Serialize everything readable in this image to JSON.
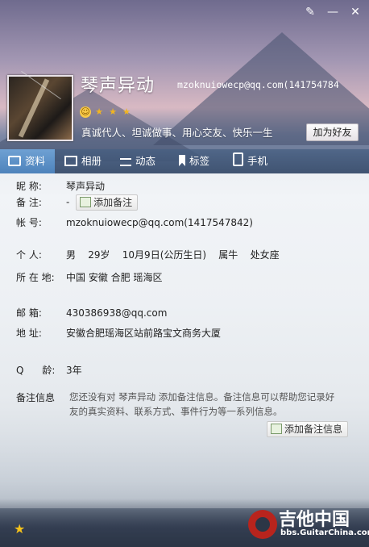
{
  "window": {
    "skin_icon": "brush-icon",
    "min_icon": "minimize-icon",
    "close_icon": "close-icon",
    "skin_glyph": "✎",
    "min_glyph": "—",
    "close_glyph": "✕"
  },
  "profile": {
    "nickname": "琴声异动",
    "email_header": "mzoknuiowecp@qq.com(141754784",
    "signature": "真诚代人、坦诚做事、用心交友、快乐一生",
    "add_friend": "加为好友",
    "level_icons": [
      "smiley-icon",
      "star-icon",
      "star-icon",
      "star-icon"
    ]
  },
  "tabs": [
    {
      "label": "资料",
      "icon": "card-icon"
    },
    {
      "label": "相册",
      "icon": "photo-icon"
    },
    {
      "label": "动态",
      "icon": "list-icon"
    },
    {
      "label": "标签",
      "icon": "tag-icon"
    },
    {
      "label": "手机",
      "icon": "phone-icon"
    }
  ],
  "details": {
    "nick_label": "昵    称:",
    "nick_value": "琴声异动",
    "remark_label": "备    注:",
    "remark_value": "-",
    "add_remark": "添加备注",
    "account_label": "帐    号:",
    "account_value": "mzoknuiowecp@qq.com(1417547842)",
    "personal_label": "个    人:",
    "personal_value": "男    29岁    10月9日(公历生日)    属牛    处女座",
    "location_label": "所 在 地:",
    "location_value": "中国 安徽 合肥 瑶海区",
    "email_label": "邮    箱:",
    "email_value": "430386938@qq.com",
    "address_label": "地    址:",
    "address_value": "安徽合肥瑶海区站前路宝文商务大厦",
    "qage_label": "Q      龄:",
    "qage_value": "3年",
    "note_label": "备注信息",
    "note_text": "您还没有对 琴声异动 添加备注信息。备注信息可以帮助您记录好友的真实资料、联系方式、事件行为等一系列信息。",
    "add_note_info": "添加备注信息"
  },
  "watermark": {
    "big": "吉他中国",
    "small": "bbs.GuitarChina.com"
  }
}
